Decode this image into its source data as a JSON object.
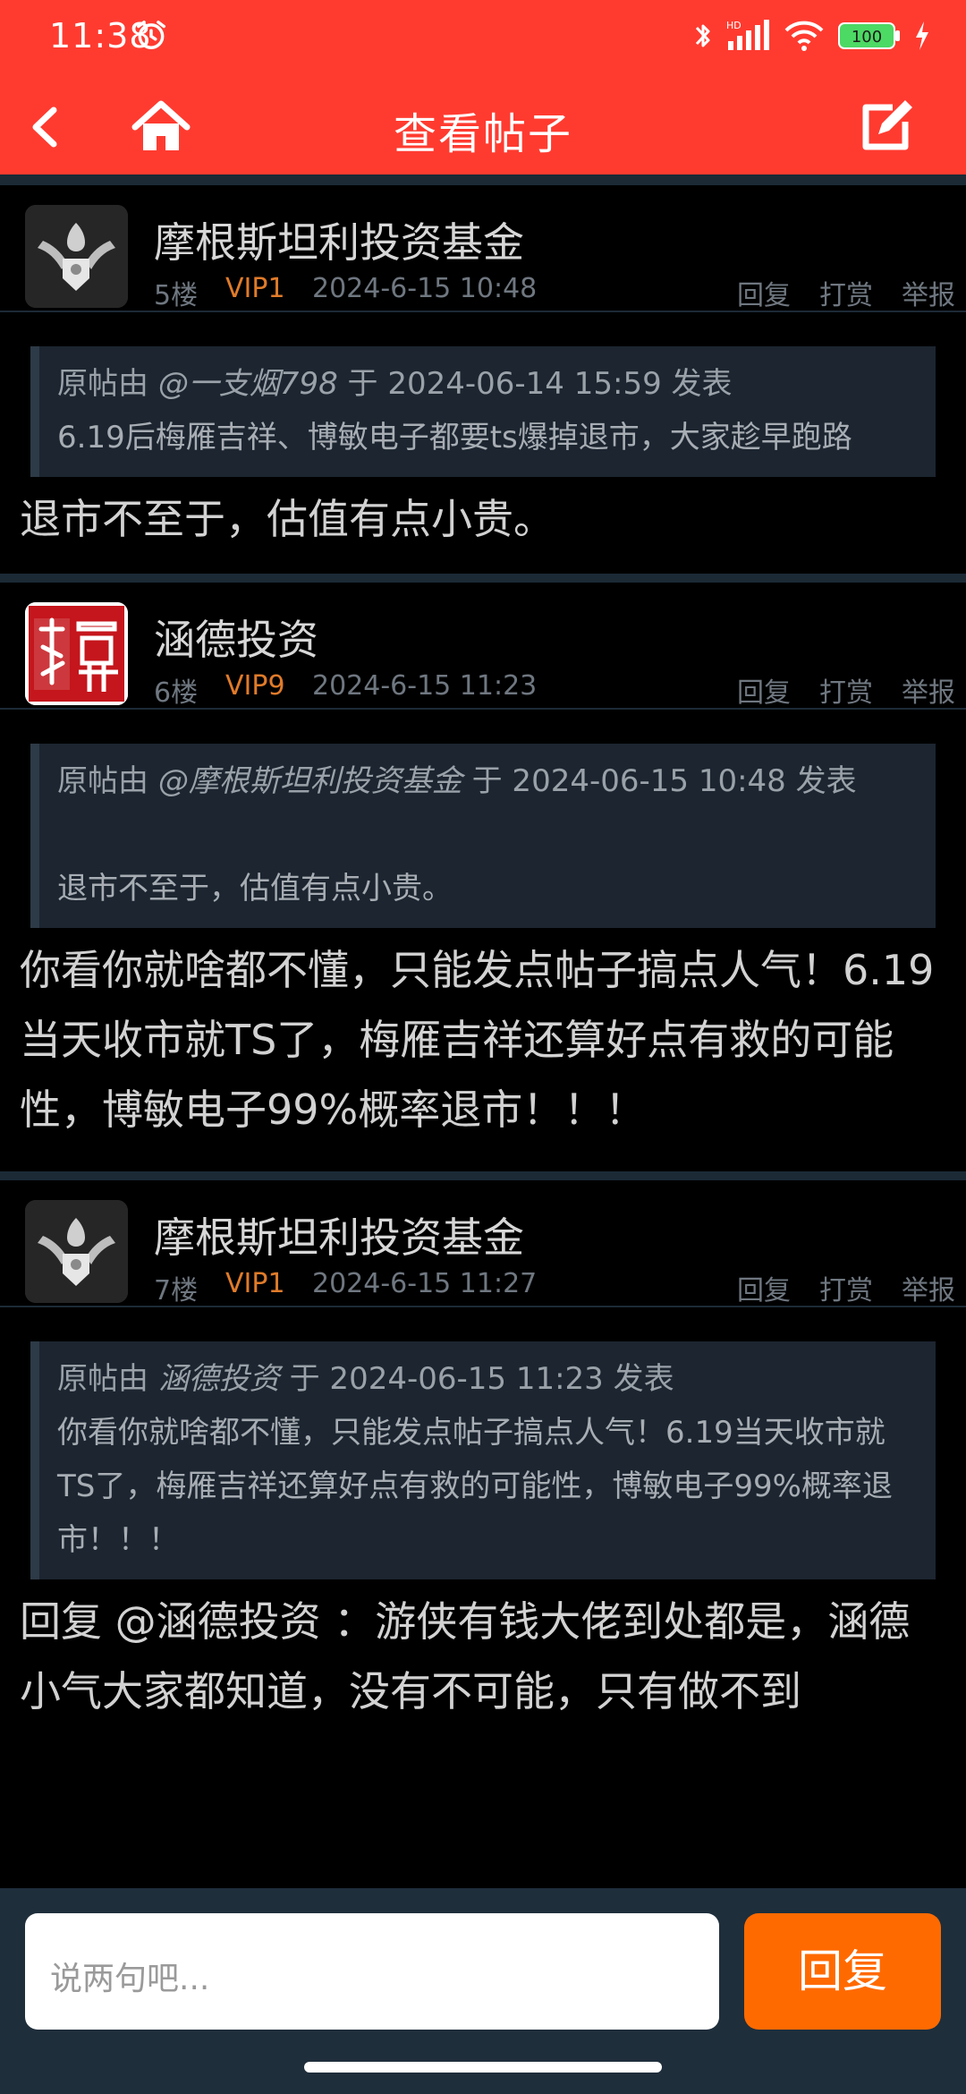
{
  "status": {
    "time": "11:38",
    "battery": "100"
  },
  "appbar": {
    "title": "查看帖子"
  },
  "posts": [
    {
      "user": "摩根斯坦利投资基金",
      "floor": "5楼",
      "vip": "VIP1",
      "time": "2024-6-15 10:48",
      "actions": [
        "回复",
        "打赏",
        "举报"
      ],
      "quote": {
        "prefix": "原帖由",
        "user": "@一支烟798",
        "mid": "于 2024-06-14 15:59 发表",
        "text": "6.19后梅雁吉祥、博敏电子都要ts爆掉退市，大家趁早跑路"
      },
      "body": "退市不至于，估值有点小贵。"
    },
    {
      "user": "涵德投资",
      "floor": "6楼",
      "vip": "VIP9",
      "time": "2024-6-15 11:23",
      "actions": [
        "回复",
        "打赏",
        "举报"
      ],
      "quote": {
        "prefix": "原帖由",
        "user": "@摩根斯坦利投资基金",
        "mid": "于 2024-06-15 10:48 发表",
        "text": "退市不至于，估值有点小贵。"
      },
      "body": "你看你就啥都不懂，只能发点帖子搞点人气！6.19当天收市就TS了，梅雁吉祥还算好点有救的可能性，博敏电子99%概率退市！！！"
    },
    {
      "user": "摩根斯坦利投资基金",
      "floor": "7楼",
      "vip": "VIP1",
      "time": "2024-6-15 11:27",
      "actions": [
        "回复",
        "打赏",
        "举报"
      ],
      "quote": {
        "prefix": "原帖由",
        "user": "涵德投资",
        "mid": "于 2024-06-15 11:23 发表",
        "text": "你看你就啥都不懂，只能发点帖子搞点人气！6.19当天收市就TS了，梅雁吉祥还算好点有救的可能性，博敏电子99%概率退市！！！"
      },
      "body": "回复 @涵德投资 ：游侠有钱大佬到处都是，涵德小气大家都知道，没有不可能，只有做不到"
    }
  ],
  "reply": {
    "placeholder": "说两句吧...",
    "button": "回复"
  },
  "colors": {
    "accent": "#ff3b30",
    "reply_button": "#ff6a00",
    "vip": "#e07b2a"
  }
}
